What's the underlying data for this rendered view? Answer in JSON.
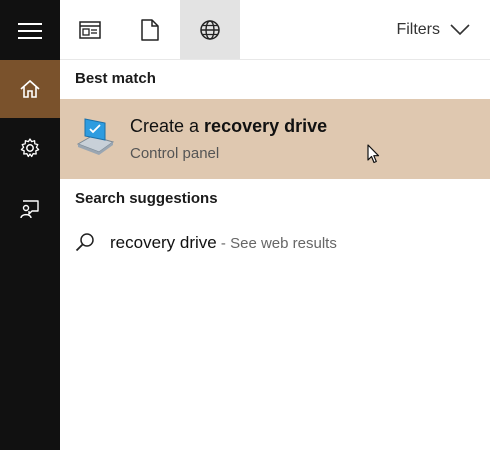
{
  "tabs": [
    "apps-tab",
    "documents-tab",
    "web-tab"
  ],
  "filters_label": "Filters",
  "sidebar": [
    "menu",
    "home",
    "settings",
    "feedback"
  ],
  "best_match": {
    "heading": "Best match",
    "title_prefix": "Create a ",
    "title_bold": "recovery drive",
    "subtitle": "Control panel"
  },
  "suggestions": {
    "heading": "Search suggestions",
    "items": [
      {
        "query": "recovery drive",
        "hint": " - See web results"
      }
    ]
  },
  "colors": {
    "sidebar_bg": "#111111",
    "sidebar_active": "#7a522c",
    "best_match_bg": "#dfc8b0",
    "tab_active": "#e3e3e3"
  }
}
